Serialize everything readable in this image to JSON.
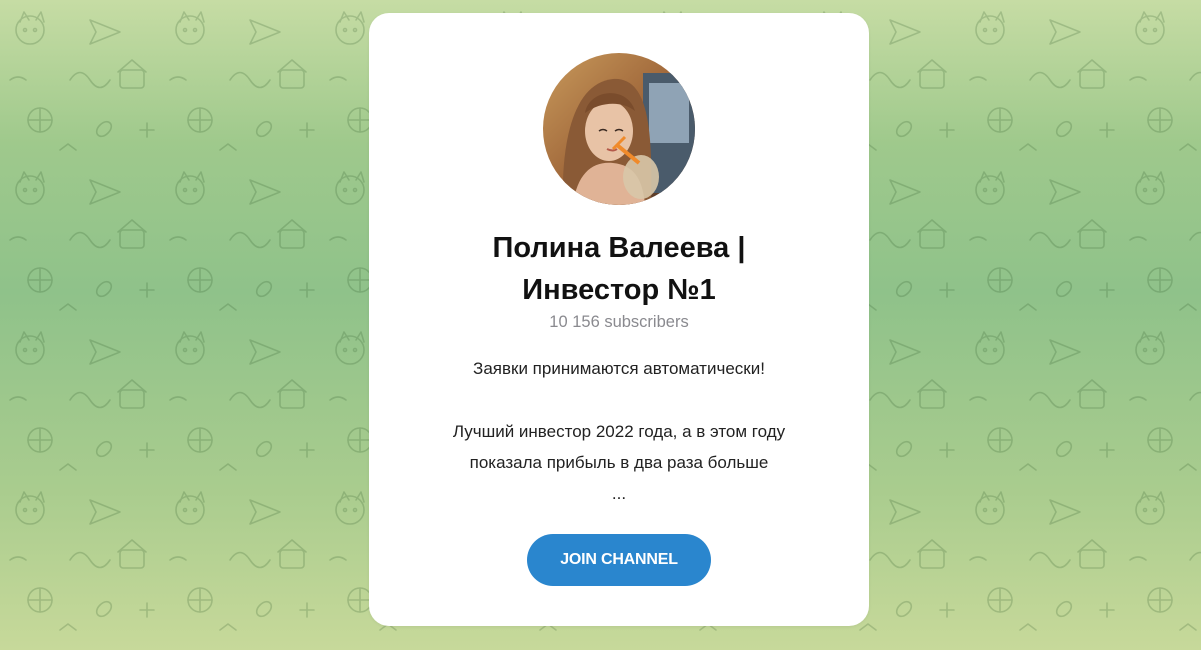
{
  "channel": {
    "title_line1": "Полина Валеева |",
    "title_line2": "Инвестор №1",
    "subscribers": "10 156 subscribers",
    "description_line1": "Заявки принимаются автоматически!",
    "description_line2": "Лучший инвестор 2022 года, а в этом году",
    "description_line3": "показала прибыль в два раза больше",
    "description_more": "...",
    "join_label": "JOIN CHANNEL"
  },
  "colors": {
    "accent": "#2a86ce",
    "background_green": "#8fc28a",
    "card": "#ffffff",
    "muted_text": "#8a8a8f"
  },
  "icons": {
    "background": "doodle-pattern",
    "avatar": "channel-avatar-photo"
  }
}
